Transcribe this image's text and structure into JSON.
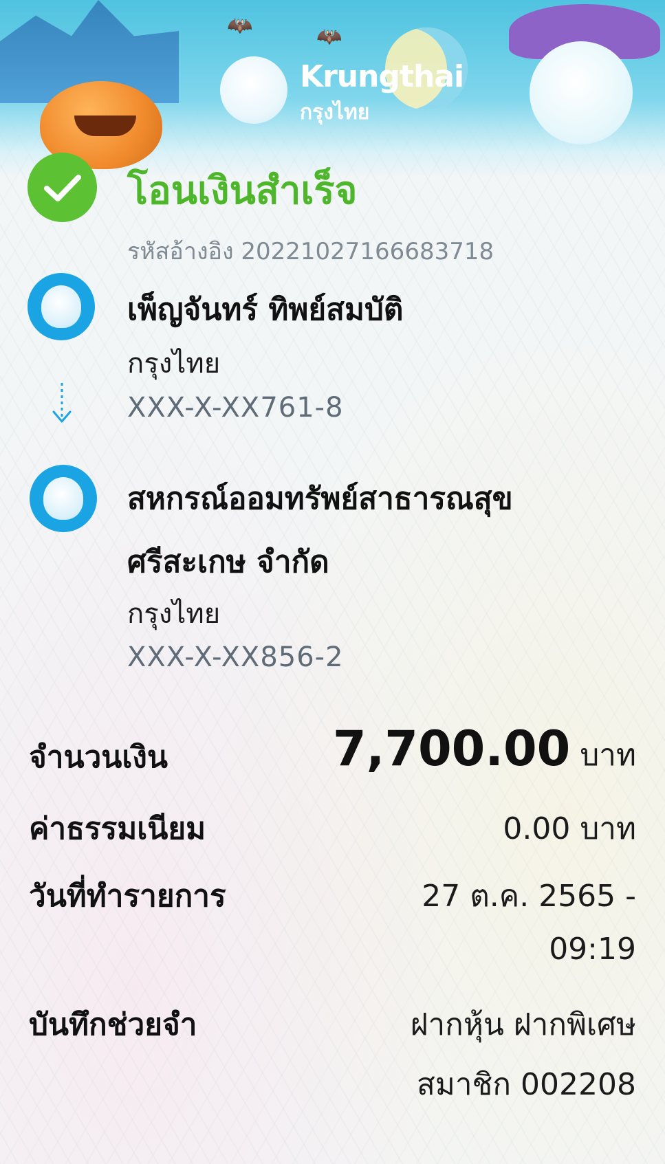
{
  "header": {
    "logo_en": "Krungthai",
    "logo_th": "กรุงไทย"
  },
  "status": {
    "title": "โอนเงินสำเร็จ",
    "reference": "รหัสอ้างอิง 2022102716668371​8"
  },
  "sender": {
    "name": "เพ็ญจันทร์ ทิพย์สมบัติ",
    "bank": "กรุงไทย",
    "account": "XXX-X-XX761-8"
  },
  "receiver": {
    "name_line1": "สหกรณ์ออมทรัพย์สาธารณสุข",
    "name_line2": "ศรีสะเกษ จำกัด",
    "bank": "กรุงไทย",
    "account": "XXX-X-XX856-2"
  },
  "details": {
    "amount_label": "จำนวนเงิน",
    "amount_value": "7,700.00",
    "amount_unit": "บาท",
    "fee_label": "ค่าธรรมเนียม",
    "fee_value": "0.00 บาท",
    "date_label": "วันที่ทำรายการ",
    "date_line1": "27 ต.ค. 2565 -",
    "date_line2": "09:19",
    "memo_label": "บันทึกช่วยจำ",
    "memo_line1": "ฝากหุ้น ฝากพิเศษ",
    "memo_line2": "สมาชิก 002208"
  },
  "colors": {
    "success": "#5cc133",
    "bank_blue": "#1aa4e3",
    "account_gray": "#5f6c77"
  }
}
